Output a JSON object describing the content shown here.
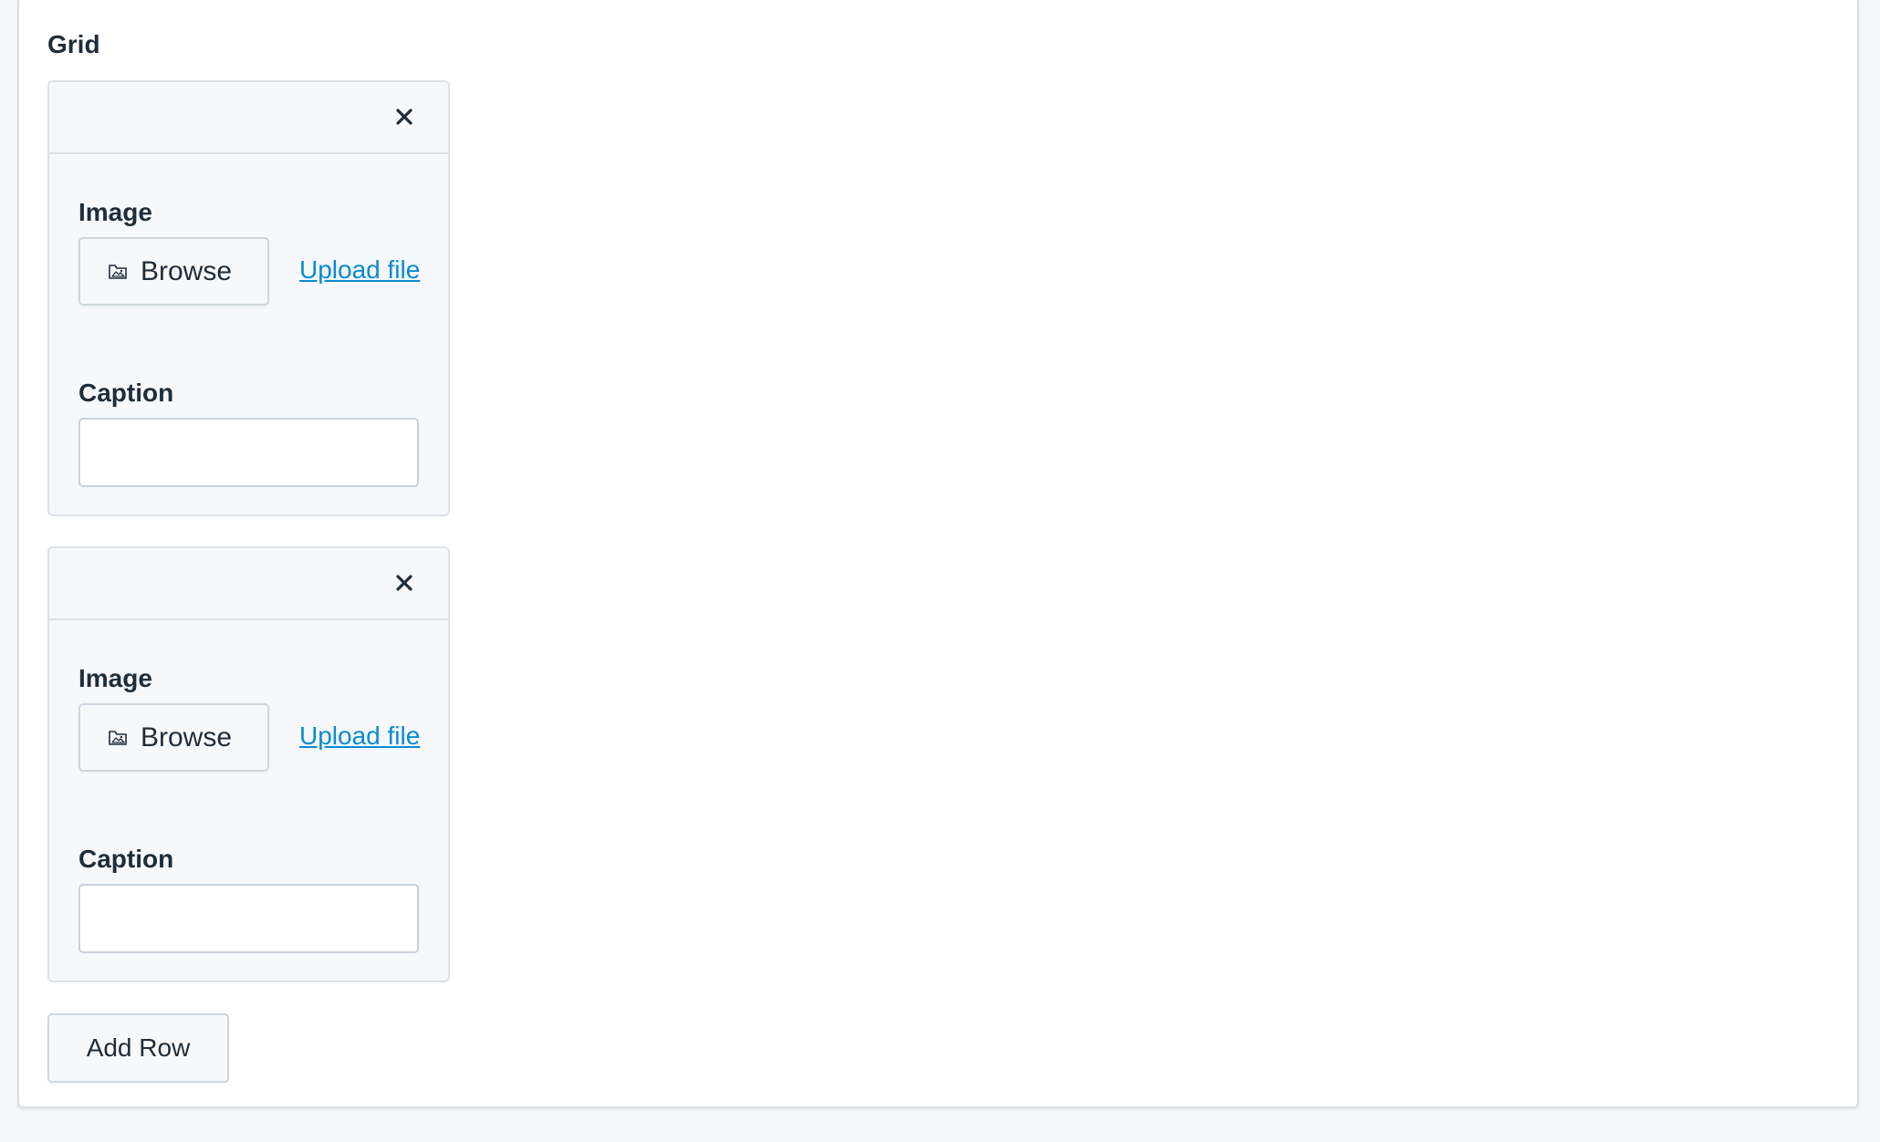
{
  "grid": {
    "title": "Grid",
    "rows": [
      {
        "image_label": "Image",
        "browse_label": "Browse",
        "upload_link": "Upload file",
        "caption_label": "Caption",
        "caption_value": ""
      },
      {
        "image_label": "Image",
        "browse_label": "Browse",
        "upload_link": "Upload file",
        "caption_label": "Caption",
        "caption_value": ""
      }
    ],
    "add_row_label": "Add Row"
  },
  "icons": {
    "remove": "close-icon",
    "browse": "image-folder-icon"
  },
  "colors": {
    "link": "#0b8ad3",
    "text": "#1f2d3a",
    "row_bg": "#f6f8fb",
    "page_bg": "#f4f6f9"
  }
}
